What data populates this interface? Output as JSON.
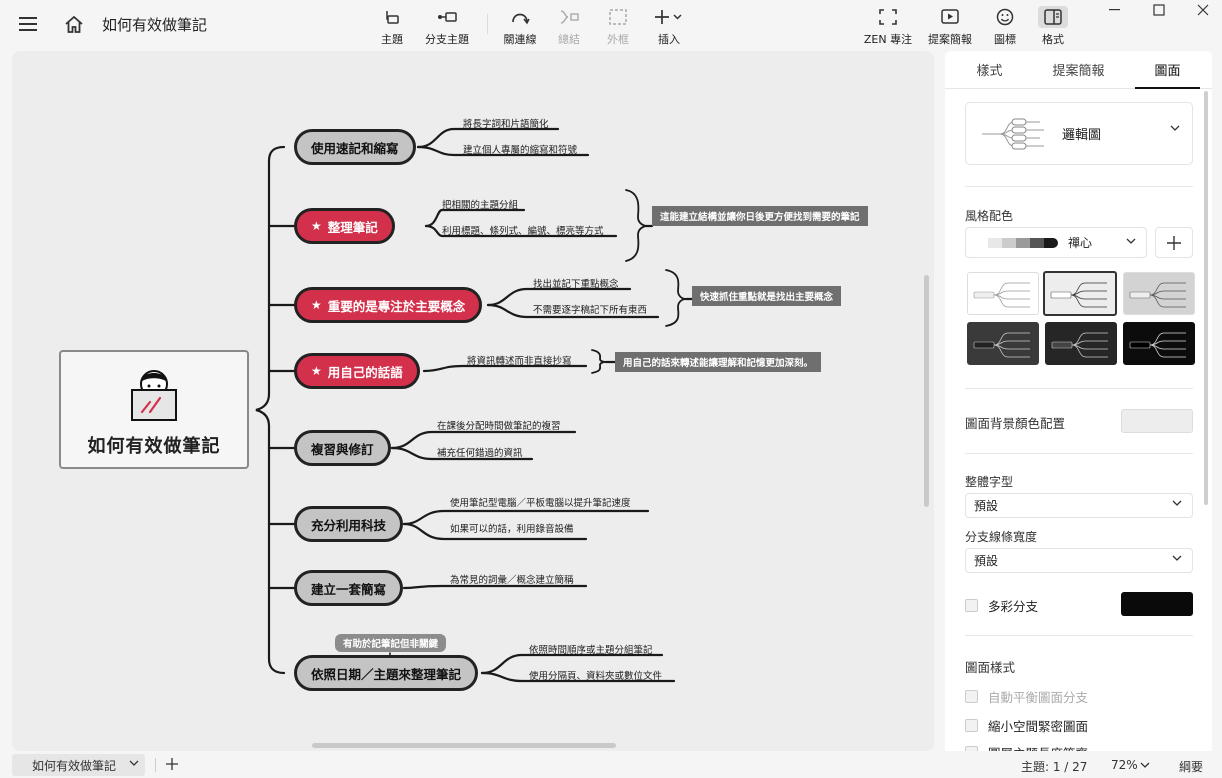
{
  "app": {
    "title": "如何有效做筆記",
    "icons": {
      "menu": "hamburger-menu-icon",
      "home": "home-icon"
    }
  },
  "toolbar": {
    "topic": "主題",
    "subtopic": "分支主題",
    "relationship": "關連線",
    "summary": "總結",
    "boundary": "外框",
    "insert": "插入",
    "zen": "ZEN 專注",
    "pitch": "提案簡報",
    "icon": "圖標",
    "format": "格式"
  },
  "map": {
    "central": "如何有效做筆記",
    "topics": [
      {
        "label": "使用速記和縮寫",
        "style": "gray",
        "subs": [
          "將長字詞和片語簡化",
          "建立個人專屬的縮寫和符號"
        ]
      },
      {
        "label": "整理筆記",
        "style": "red",
        "subs": [
          "把相關的主題分組",
          "利用標題、條列式、編號、標亮等方式"
        ],
        "callout": "這能建立結構並讓你日後更方便找到需要的筆記"
      },
      {
        "label": "重要的是專注於主要概念",
        "style": "red",
        "subs": [
          "找出並記下重點概念",
          "不需要逐字稿記下所有東西"
        ],
        "callout": "快速抓住重點就是找出主要概念"
      },
      {
        "label": "用自己的話語",
        "style": "red",
        "subs": [
          "將資訊轉述而非直接抄寫"
        ],
        "callout": "用自己的話來轉述能讓理解和記憶更加深刻。"
      },
      {
        "label": "複習與修訂",
        "style": "gray",
        "subs": [
          "在課後分配時間做筆記的複習",
          "補充任何錯過的資訊"
        ]
      },
      {
        "label": "充分利用科技",
        "style": "gray",
        "subs": [
          "使用筆記型電腦／平板電腦以提升筆記速度",
          "如果可以的話，利用錄音設備"
        ]
      },
      {
        "label": "建立一套簡寫",
        "style": "gray",
        "subs": [
          "為常見的詞彙／概念建立簡稱"
        ]
      },
      {
        "label": "依照日期／主題來整理筆記",
        "style": "gray",
        "subs": [
          "依照時間順序或主題分組筆記",
          "使用分隔頁、資料夾或數位文件"
        ],
        "floating": "有助於記筆記但非關鍵"
      }
    ]
  },
  "panel": {
    "tabs": [
      "樣式",
      "提案簡報",
      "圖面"
    ],
    "active_tab": "圖面",
    "structure": "邏輯圖",
    "color_theme_label": "風格配色",
    "color_theme": "禪心",
    "theme_swatches": [
      "#e8e8e8",
      "#cccccc",
      "#9a9a9a",
      "#555555",
      "#1a1a1a"
    ],
    "bg_color_label": "圖面背景顏色配置",
    "bg_color": "#ededed",
    "font_label": "整體字型",
    "font_value": "預設",
    "branch_width_label": "分支線條寬度",
    "branch_width_value": "預設",
    "rainbow_label": "多彩分支",
    "rainbow_color": "#0a0a0a",
    "map_style_label": "圖面樣式",
    "auto_balance": "自動平衡圖面分支",
    "compact": "縮小空間緊密圖面",
    "cut_off": "圖層主題長度等齊"
  },
  "status": {
    "sheet": "如何有效做筆記",
    "topic_count": "主題: 1 / 27",
    "zoom": "72%",
    "outline": "綱要"
  }
}
